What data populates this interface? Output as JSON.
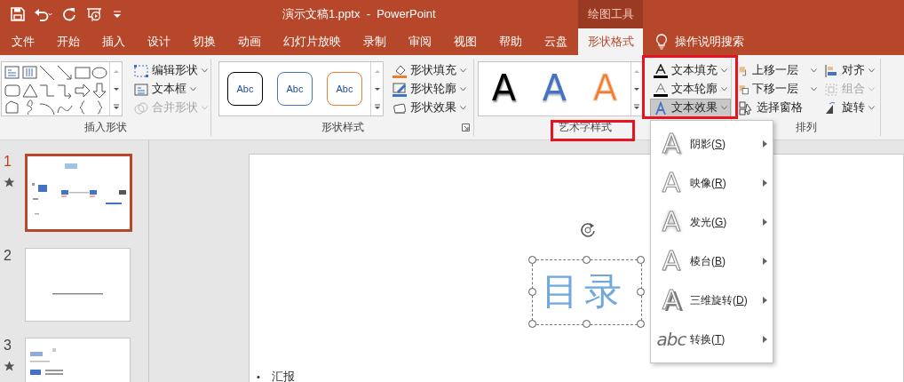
{
  "title_bar": {
    "title": "演示文稿1.pptx  -  PowerPoint",
    "context_group": "绘图工具"
  },
  "menu_tabs": [
    {
      "label": "文件",
      "selected": false
    },
    {
      "label": "开始",
      "selected": false
    },
    {
      "label": "插入",
      "selected": false
    },
    {
      "label": "设计",
      "selected": false
    },
    {
      "label": "切换",
      "selected": false
    },
    {
      "label": "动画",
      "selected": false
    },
    {
      "label": "幻灯片放映",
      "selected": false
    },
    {
      "label": "录制",
      "selected": false
    },
    {
      "label": "审阅",
      "selected": false
    },
    {
      "label": "视图",
      "selected": false
    },
    {
      "label": "帮助",
      "selected": false
    },
    {
      "label": "云盘",
      "selected": false
    },
    {
      "label": "形状格式",
      "selected": true
    }
  ],
  "tell_me": "操作说明搜索",
  "insert_shapes": {
    "buttons": [
      {
        "label": "编辑形状",
        "disabled": false
      },
      {
        "label": "文本框",
        "disabled": false
      },
      {
        "label": "合并形状",
        "disabled": true
      }
    ],
    "group_label": "插入形状"
  },
  "shape_styles": {
    "presets": [
      {
        "text": "Abc",
        "color": "#000000"
      },
      {
        "text": "Abc",
        "color": "#4472c4"
      },
      {
        "text": "Abc",
        "color": "#ed7d31"
      }
    ],
    "buttons": [
      {
        "label": "形状填充",
        "kind": "fill"
      },
      {
        "label": "形状轮廓",
        "kind": "outline"
      },
      {
        "label": "形状效果",
        "kind": "effect"
      }
    ],
    "group_label": "形状样式"
  },
  "wordart_styles": {
    "presets": [
      {
        "text": "A",
        "color": "#000000"
      },
      {
        "text": "A",
        "color": "#4472c4"
      },
      {
        "text": "A",
        "color": "#ed7d31"
      }
    ],
    "buttons": [
      {
        "label": "文本填充",
        "kind": "fill",
        "pressed": false
      },
      {
        "label": "文本轮廓",
        "kind": "outline",
        "pressed": false
      },
      {
        "label": "文本效果",
        "kind": "effect",
        "pressed": true
      }
    ],
    "group_label": "艺术字样式",
    "buttons_highlighted": true,
    "label_highlighted": true
  },
  "arrange": {
    "buttons": [
      {
        "label": "上移一层",
        "kind": "forward",
        "disabled": false
      },
      {
        "label": "下移一层",
        "kind": "backward",
        "disabled": false
      },
      {
        "label": "选择窗格",
        "kind": "pane",
        "disabled": false
      },
      {
        "label": "对齐",
        "kind": "align",
        "disabled": false
      },
      {
        "label": "组合",
        "kind": "group",
        "disabled": true
      },
      {
        "label": "旋转",
        "kind": "rotate",
        "disabled": false
      }
    ],
    "group_label": "排列"
  },
  "slides": [
    {
      "number": "1",
      "selected": true,
      "starred": true,
      "kind": "toc"
    },
    {
      "number": "2",
      "selected": false,
      "starred": false,
      "kind": "line"
    },
    {
      "number": "3",
      "selected": false,
      "starred": true,
      "kind": "list"
    }
  ],
  "slide": {
    "textbox": "目录",
    "bullet": "•",
    "bullet_text": "汇报"
  },
  "effects_menu": {
    "items": [
      {
        "icon_text": "A",
        "kind": "shadow",
        "label": "阴影(S)"
      },
      {
        "icon_text": "A",
        "kind": "reflection",
        "label": "映像(R)"
      },
      {
        "icon_text": "A",
        "kind": "glow",
        "label": "发光(G)"
      },
      {
        "icon_text": "A",
        "kind": "bevel",
        "label": "棱台(B)"
      },
      {
        "icon_text": "A",
        "kind": "rotation",
        "label": "三维旋转(D)"
      },
      {
        "icon_text": "abc",
        "kind": "transform",
        "label": "转换(T)"
      }
    ]
  }
}
